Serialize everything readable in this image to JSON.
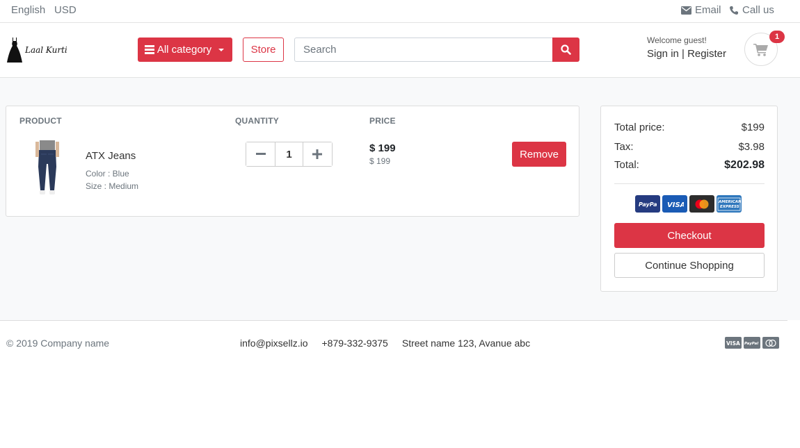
{
  "topbar": {
    "language": "English",
    "currency": "USD",
    "email_label": "Email",
    "call_label": "Call us"
  },
  "header": {
    "logo_text": "Laal Kurti",
    "category_label": "All category",
    "store_label": "Store",
    "search_placeholder": "Search",
    "welcome": "Welcome guest!",
    "signin": "Sign in | Register",
    "cart_count": "1"
  },
  "cart": {
    "col_product": "PRODUCT",
    "col_quantity": "QUANTITY",
    "col_price": "PRICE",
    "items": [
      {
        "name": "ATX Jeans",
        "color": "Color : Blue",
        "size": "Size : Medium",
        "quantity": "1",
        "price": "$ 199",
        "unit_price": "$ 199",
        "remove_label": "Remove"
      }
    ]
  },
  "summary": {
    "total_price_label": "Total price:",
    "total_price_value": "$199",
    "tax_label": "Tax:",
    "tax_value": "$3.98",
    "total_label": "Total:",
    "total_value": "$202.98",
    "payment_icons": [
      "paypal-icon",
      "visa-icon",
      "mastercard-icon",
      "amex-icon"
    ],
    "checkout_label": "Checkout",
    "continue_label": "Continue Shopping"
  },
  "footer": {
    "copyright": "© 2019 Company name",
    "email": "info@pixsellz.io",
    "phone": "+879-332-9375",
    "address": "Street name 123, Avanue abc",
    "payment_icons": [
      "visa-icon",
      "paypal-icon",
      "mastercard-icon"
    ]
  },
  "colors": {
    "accent": "#dc3545",
    "muted": "#6c757d",
    "background": "#f8f9fa"
  }
}
